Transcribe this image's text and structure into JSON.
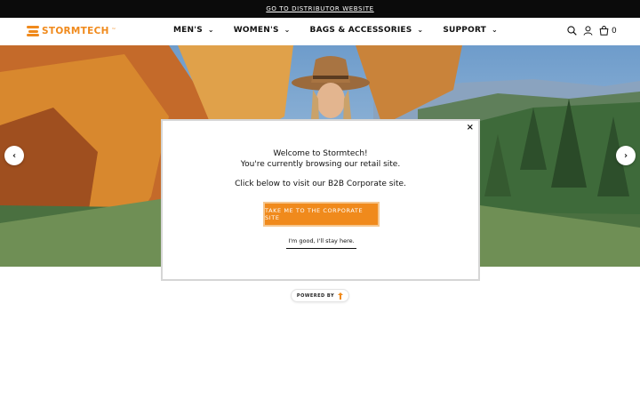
{
  "announcement": {
    "link_text": "GO TO DISTRIBUTOR WEBSITE"
  },
  "brand": {
    "name": "STORMTECH",
    "color": "#f08a1c"
  },
  "nav": {
    "items": [
      {
        "label": "MEN'S"
      },
      {
        "label": "WOMEN'S"
      },
      {
        "label": "BAGS & ACCESSORIES"
      },
      {
        "label": "SUPPORT"
      }
    ],
    "chevron": "⌄"
  },
  "header_icons": {
    "search": "search-icon",
    "account": "user-icon",
    "cart": "bag-icon",
    "cart_count": "0"
  },
  "carousel": {
    "prev": "‹",
    "next": "›"
  },
  "modal": {
    "close": "×",
    "line1": "Welcome to Stormtech!",
    "line2": "You're currently browsing our retail site.",
    "line3": "Click below to visit our B2B Corporate site.",
    "cta_label": "TAKE ME TO THE CORPORATE SITE",
    "stay_label": "I'm good, I'll stay here."
  },
  "powered_by": {
    "label": "POWERED BY"
  }
}
